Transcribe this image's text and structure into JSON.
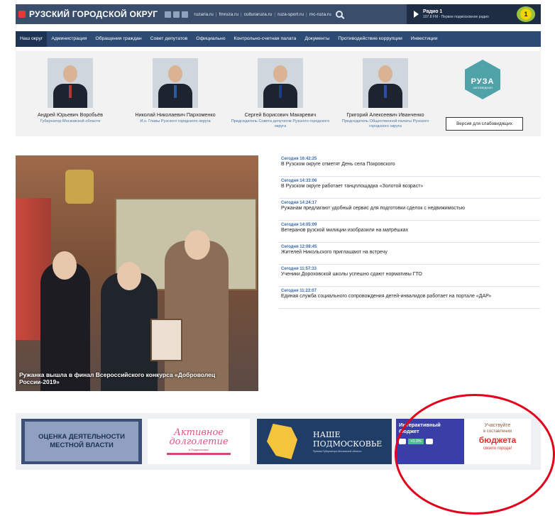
{
  "header": {
    "site_title": "РУЗСКИЙ ГОРОДСКОЙ ОКРУГ",
    "links": [
      "ruzaria.ru",
      "fmruza.ru",
      "culturaruza.ru",
      "ruza-sport.ru",
      "mc-ruza.ru"
    ],
    "radio": {
      "name": "Радио 1",
      "sub": "107.8 FM - Первое подмосковное радио",
      "logo_text": "1"
    }
  },
  "nav": {
    "items": [
      "Наш округ",
      "Администрация",
      "Обращения граждан",
      "Совет депутатов",
      "Официально",
      "Контрольно-счетная палата",
      "Документы",
      "Противодействие коррупции",
      "Инвестиции"
    ]
  },
  "persons": [
    {
      "name": "Андрей Юрьевич Воробьёв",
      "role": "Губернатор Московской области"
    },
    {
      "name": "Николай Николаевич Пархоменко",
      "role": "И.о. Главы Рузского городского округа"
    },
    {
      "name": "Сергей Борисович Макаревич",
      "role": "Председатель Совета депутатов Рузского городского округа"
    },
    {
      "name": "Григорий Алексеевич Иванченко",
      "role": "Председатель Общественной палаты Рузского городского округа"
    }
  ],
  "ruza_badge": {
    "title": "РУЗА",
    "sub": "ЗАПОВЕДНАЯ"
  },
  "accessibility_button": "Версия для слабовидящих",
  "feature": {
    "caption": "Ружанка вышла в финал Всероссийского конкурса «Доброволец России-2019»"
  },
  "news": [
    {
      "time": "Сегодня 16:42:25",
      "title": "В Рузском округе отметят День села Покровского"
    },
    {
      "time": "Сегодня 14:33:06",
      "title": "В Рузском округе работает танцплощадка «Золотой возраст»"
    },
    {
      "time": "Сегодня 14:24:17",
      "title": "Ружанам предлагают удобный сервис для подготовки сделок с недвижимостью"
    },
    {
      "time": "Сегодня 14:05:09",
      "title": "Ветеранов рузской милиции изобразили на матрёшках"
    },
    {
      "time": "Сегодня 12:08:45",
      "title": "Жителей Никольского приглашают на встречу"
    },
    {
      "time": "Сегодня 11:57:33",
      "title": "Ученики Дороховской школы успешно сдают нормативы ГТО"
    },
    {
      "time": "Сегодня 11:22:07",
      "title": "Единая служба социального сопровождения детей-инвалидов работает на портале «ДАР»"
    }
  ],
  "banners": {
    "b1": "ОЦЕНКА ДЕЯТЕЛЬНОСТИ МЕСТНОЙ ВЛАСТИ",
    "b2_title": "Активное долголетие",
    "b2_sub": "в Подмосковье",
    "b3_title": "НАШЕ ПОДМОСКОВЬЕ",
    "b3_sub": "Премия Губернатора Московской области",
    "b4_title": "Интерактивный бюджет",
    "b4_badge": "+0.3%",
    "b4_r1": "Участвуйте",
    "b4_r2": "в составлении",
    "b4_r3": "бюджета",
    "b4_r4": "своего города!"
  },
  "colors": {
    "header": "#3a4e6b",
    "nav": "#2d4a73",
    "accent_link": "#3b6aa9",
    "highlight_ring": "#e3001b"
  }
}
